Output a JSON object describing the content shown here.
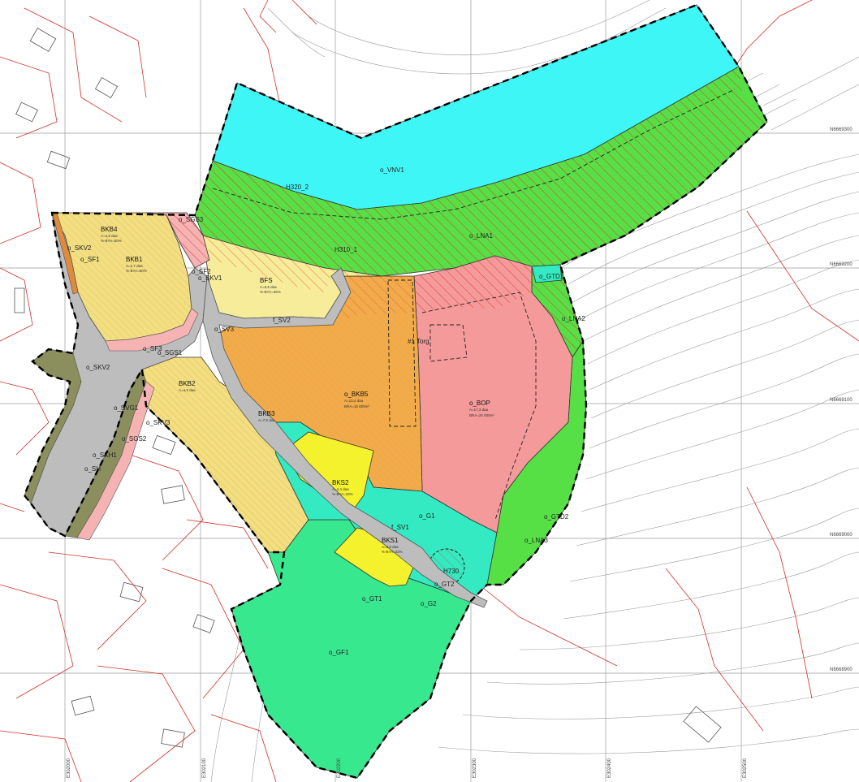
{
  "map": {
    "colors": {
      "water": "#3ff6f6",
      "lna": "#56e046",
      "bop": "#f59a9a",
      "bkb": "#f2df82",
      "bkb5": "#f2ab4a",
      "bks": "#f4f22c",
      "green": "#33eac2",
      "park": "#37e88f",
      "road": "#bdbdbd",
      "sidewalk": "#f6b3b3",
      "verge": "#8b8e5d",
      "hatch": "#e03a2e",
      "boundary": "#000000"
    },
    "zones": {
      "o_VNV1": "o_VNV1",
      "H320_2": "H320_2",
      "o_LNA1": "o_LNA1",
      "H310_1": "H310_1",
      "o_GTD1": "o_GTD1",
      "o_LNA2": "o_LNA2",
      "o_SGS3": "o_SGS3",
      "BKB4": "BKB4",
      "BKB4_sub1": "A=4,5 daa",
      "BKB4_sub2": "%-BYA=50%",
      "o_SKV2_top": "o_SKV2",
      "o_SF1": "o_SF1",
      "BKB1": "BKB1",
      "BKB1_sub1": "A=2,7 daa",
      "BKB1_sub2": "%-BYA=50%",
      "o_SF2": "o_SF2",
      "o_SKV1": "o_SKV1",
      "BFS": "BFS",
      "BFS_sub1": "A=5,5 daa",
      "BFS_sub2": "%-BYA=35%",
      "f_SV2": "f_SV2",
      "o_SV3": "o_SV3",
      "torg": "#1 Torg",
      "o_SKV2": "o_SKV2",
      "o_SGS1": "o_SGS1",
      "o_SF3": "o_SF3",
      "BKB2": "BKB2",
      "BKB2_sub": "A=4,9 daa",
      "o_SVG1": "o_SVG1",
      "o_SKV3": "o_SKV3",
      "o_SGS2": "o_SGS2",
      "o_SKH1": "o_SKH1",
      "o_SH": "o_SH",
      "BKB5": "o_BKB5",
      "BKB5_sub1": "A=13,4 daa",
      "BKB5_sub2": "BRA=15 000m²",
      "BKB3": "BKB3",
      "BKB3_sub": "A=7,6 daa",
      "o_BOP": "o_BOP",
      "o_BOP_sub1": "A=17,3 daa",
      "o_BOP_sub2": "BRA=20 000m²",
      "BKS2": "BKS2",
      "BKS2_sub1": "A=4,4 daa",
      "BKS2_sub2": "%-BYA=33%",
      "o_G1": "o_G1",
      "f_SV1": "f_SV1",
      "BKS1": "BKS1",
      "BKS1_sub1": "A=2,6 daa",
      "BKS1_sub2": "%-BYA=33%",
      "o_GTD2": "o_GTD2",
      "o_LNA3": "o_LNA3",
      "H730": "H730",
      "o_GT2": "o_GT2",
      "o_GT1": "o_GT1",
      "o_G2": "o_G2",
      "o_GF1": "o_GF1"
    },
    "coords": {
      "n1": "N6669300",
      "n2": "N6669200",
      "n3": "N6669100",
      "n4": "N6669000",
      "n5": "N6668900",
      "e1": "E302000",
      "e2": "E302100",
      "e3": "E302200",
      "e4": "E302300",
      "e5": "E302400",
      "e6": "E302500"
    }
  }
}
